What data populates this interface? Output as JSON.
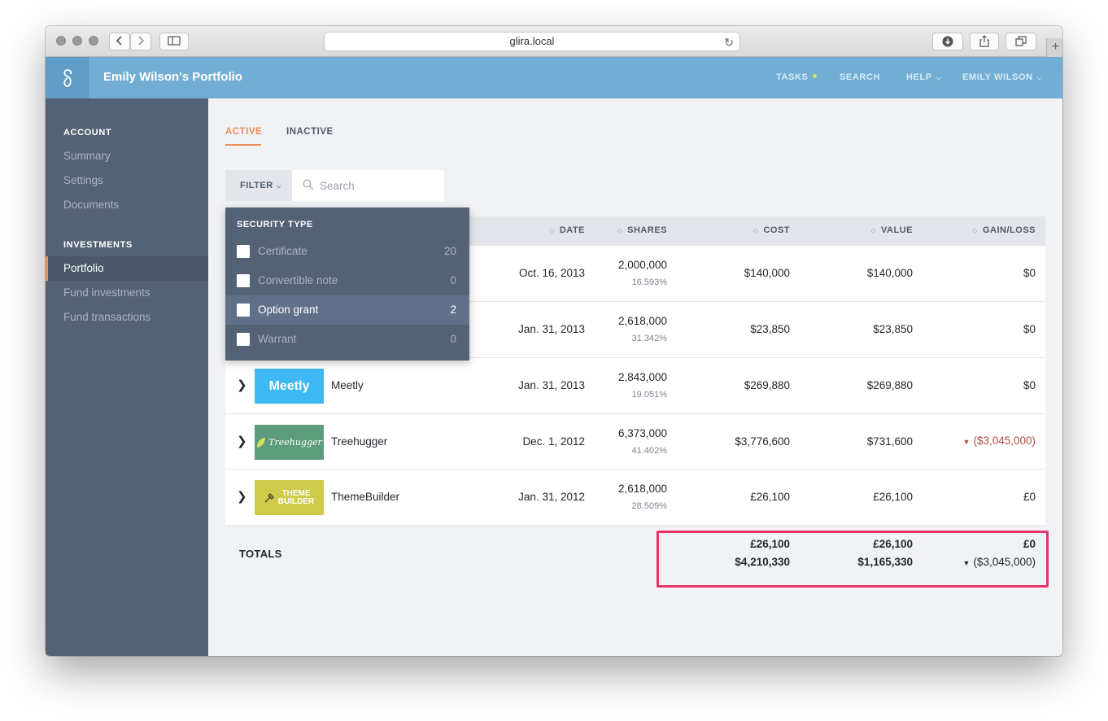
{
  "browser": {
    "url": "glira.local",
    "back_icon": "chevron-left-icon",
    "forward_icon": "chevron-right-icon",
    "sidebar_icon": "sidebar-icon",
    "reload_icon": "reload-icon",
    "download_icon": "download-icon",
    "share_icon": "share-icon",
    "tabs_icon": "tabs-icon",
    "new_tab": "+"
  },
  "header": {
    "title": "Emily Wilson's Portfolio",
    "nav": {
      "tasks": "TASKS",
      "search": "SEARCH",
      "help": "HELP",
      "user": "EMILY WILSON"
    },
    "brand_color": "#72aed4",
    "task_dot_color": "#d6e15a"
  },
  "sidebar": {
    "account_heading": "ACCOUNT",
    "account_items": [
      "Summary",
      "Settings",
      "Documents"
    ],
    "investments_heading": "INVESTMENTS",
    "investment_items": [
      "Portfolio",
      "Fund investments",
      "Fund transactions"
    ],
    "active_item": "Portfolio",
    "bg_color": "#546276",
    "accent_color": "#f08c59"
  },
  "tabs": {
    "active": "ACTIVE",
    "inactive": "INACTIVE"
  },
  "filter": {
    "label": "FILTER",
    "search_placeholder": "Search",
    "dropdown_title": "SECURITY TYPE",
    "options": [
      {
        "label": "Certificate",
        "count": "20",
        "checked": false
      },
      {
        "label": "Convertible note",
        "count": "0",
        "checked": false
      },
      {
        "label": "Option grant",
        "count": "2",
        "checked": false
      },
      {
        "label": "Warrant",
        "count": "0",
        "checked": false
      }
    ],
    "highlighted_option": "Option grant"
  },
  "table": {
    "columns": {
      "date": "DATE",
      "shares": "SHARES",
      "cost": "COST",
      "value": "VALUE",
      "gain_loss": "GAIN/LOSS"
    },
    "rows": [
      {
        "company": "",
        "logo": "",
        "date": "Oct. 16, 2013",
        "shares": "2,000,000",
        "percent": "16.593%",
        "cost": "$140,000",
        "value": "$140,000",
        "gain_loss": "$0",
        "loss": false
      },
      {
        "company": "",
        "logo": "",
        "date": "Jan. 31, 2013",
        "shares": "2,618,000",
        "percent": "31.342%",
        "cost": "$23,850",
        "value": "$23,850",
        "gain_loss": "$0",
        "loss": false
      },
      {
        "company": "Meetly",
        "logo": "Meetly",
        "logo_color": "#3eb8f0",
        "date": "Jan. 31, 2013",
        "shares": "2,843,000",
        "percent": "19.051%",
        "cost": "$269,880",
        "value": "$269,880",
        "gain_loss": "$0",
        "loss": false
      },
      {
        "company": "Treehugger",
        "logo": "Treehugger",
        "logo_color": "#5c9b7c",
        "date": "Dec. 1, 2012",
        "shares": "6,373,000",
        "percent": "41.402%",
        "cost": "$3,776,600",
        "value": "$731,600",
        "gain_loss": "($3,045,000)",
        "loss": true
      },
      {
        "company": "ThemeBuilder",
        "logo": "THEME BUILDER",
        "logo_color": "#cfcb4a",
        "date": "Jan. 31, 2012",
        "shares": "2,618,000",
        "percent": "28.509%",
        "cost": "£26,100",
        "value": "£26,100",
        "gain_loss": "£0",
        "loss": false
      }
    ],
    "totals": {
      "label": "TOTALS",
      "cost": [
        "£26,100",
        "$4,210,330"
      ],
      "value": [
        "£26,100",
        "$1,165,330"
      ],
      "gain_loss": [
        "£0",
        "($3,045,000)"
      ]
    },
    "loss_color": "#b34a3c",
    "highlight_color": "#e8336a"
  }
}
